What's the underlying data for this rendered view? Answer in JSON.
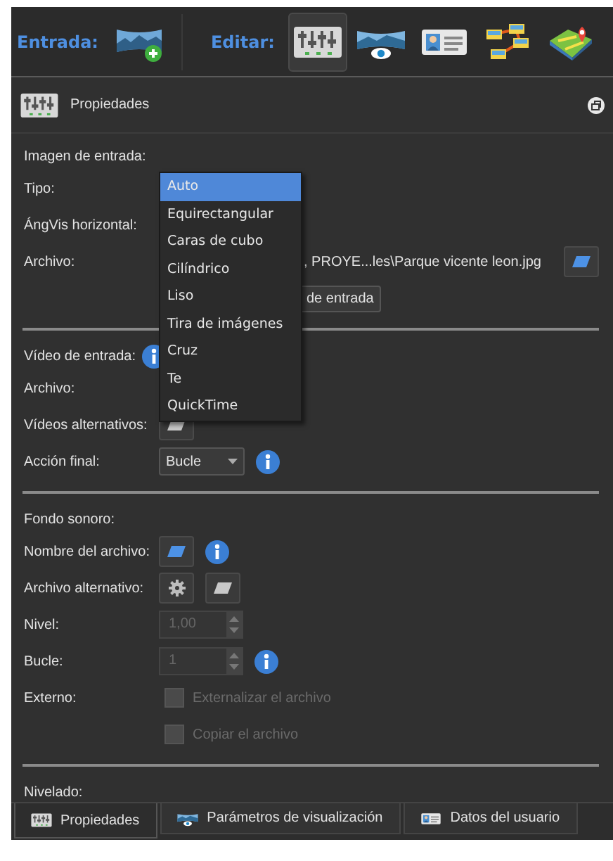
{
  "toolbar": {
    "input_label": "Entrada:",
    "edit_label": "Editar:",
    "input_tool": {
      "kind": "add"
    },
    "edit_tools": [
      {
        "kind": "properties",
        "selected": true
      },
      {
        "kind": "viewer",
        "selected": false
      },
      {
        "kind": "user",
        "selected": false
      },
      {
        "kind": "tour",
        "selected": false
      },
      {
        "kind": "map",
        "selected": false
      }
    ]
  },
  "panel": {
    "title": "Propiedades"
  },
  "form": {
    "sections": [
      {
        "heading": "Imagen de entrada:",
        "heading_info": false,
        "rows": [
          {
            "label": "Tipo:"
          },
          {
            "label": "ÁngVis horizontal:"
          },
          {
            "label": "Archivo:",
            "controls": [
              {
                "kind": "value",
                "text": ", PROYE...les\\Parque vicente leon.jpg"
              },
              {
                "kind": "folder",
                "disabled": false
              }
            ]
          },
          {
            "controls": [
              {
                "kind": "button",
                "text": "de entrada"
              }
            ]
          }
        ]
      },
      {
        "heading": "Vídeo de entrada:",
        "heading_info": true,
        "rows": [
          {
            "label": "Archivo:"
          },
          {
            "label": "Vídeos alternativos:",
            "controls": [
              {
                "kind": "folder",
                "disabled": true
              }
            ]
          },
          {
            "label": "Acción final:",
            "controls": [
              {
                "kind": "combo",
                "value": "Bucle"
              },
              {
                "kind": "info"
              }
            ]
          }
        ]
      },
      {
        "heading": "Fondo sonoro:",
        "heading_info": false,
        "rows": [
          {
            "label": "Nombre del archivo:",
            "controls": [
              {
                "kind": "folder",
                "disabled": false
              },
              {
                "kind": "info"
              }
            ]
          },
          {
            "label": "Archivo alternativo:",
            "controls": [
              {
                "kind": "gear"
              },
              {
                "kind": "folder",
                "disabled": true
              }
            ]
          },
          {
            "label": "Nivel:",
            "controls": [
              {
                "kind": "spin",
                "value": "1,00",
                "disabled": true
              }
            ]
          },
          {
            "label": "Bucle:",
            "controls": [
              {
                "kind": "spin",
                "value": "1",
                "disabled": true
              },
              {
                "kind": "info"
              }
            ]
          },
          {
            "label": "Externo:",
            "controls": [
              {
                "kind": "checkbox",
                "label": "Externalizar el archivo",
                "checked": false,
                "disabled": true
              }
            ]
          },
          {
            "controls": [
              {
                "kind": "checkbox",
                "label": "Copiar el archivo",
                "checked": false,
                "disabled": true
              }
            ]
          }
        ]
      },
      {
        "heading": "Nivelado:",
        "heading_info": false
      }
    ],
    "dropdown": [
      {
        "label": "Auto",
        "selected": true
      },
      {
        "label": "Equirectangular",
        "selected": false
      },
      {
        "label": "Caras de cubo",
        "selected": false
      },
      {
        "label": "Cilíndrico",
        "selected": false
      },
      {
        "label": "Liso",
        "selected": false
      },
      {
        "label": "Tira de imágenes",
        "selected": false
      },
      {
        "label": "Cruz",
        "selected": false
      },
      {
        "label": "Te",
        "selected": false
      },
      {
        "label": "QuickTime",
        "selected": false
      }
    ]
  },
  "tabs": [
    {
      "kind": "properties",
      "label": "Propiedades",
      "selected": true
    },
    {
      "kind": "viewer",
      "label": "Parámetros de visualización",
      "selected": false
    },
    {
      "kind": "user",
      "label": "Datos del usuario",
      "selected": false
    }
  ]
}
